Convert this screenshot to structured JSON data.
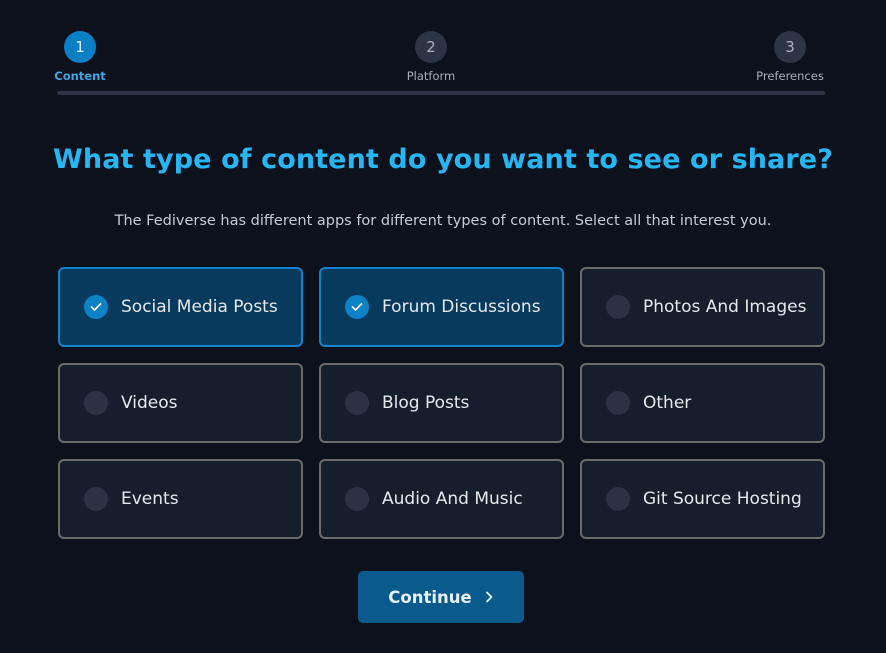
{
  "stepper": {
    "steps": [
      {
        "number": "1",
        "label": "Content",
        "active": true
      },
      {
        "number": "2",
        "label": "Platform",
        "active": false
      },
      {
        "number": "3",
        "label": "Preferences",
        "active": false
      }
    ]
  },
  "main": {
    "title": "What type of content do you want to see or share?",
    "subtitle": "The Fediverse has different apps for different types of content. Select all that interest you.",
    "options": [
      {
        "label": "Social Media Posts",
        "selected": true
      },
      {
        "label": "Forum Discussions",
        "selected": true
      },
      {
        "label": "Photos And Images",
        "selected": false
      },
      {
        "label": "Videos",
        "selected": false
      },
      {
        "label": "Blog Posts",
        "selected": false
      },
      {
        "label": "Other",
        "selected": false
      },
      {
        "label": "Events",
        "selected": false
      },
      {
        "label": "Audio And Music",
        "selected": false
      },
      {
        "label": "Git Source Hosting",
        "selected": false
      }
    ],
    "continue_label": "Continue"
  },
  "icons": {
    "check": "check-icon",
    "continue": "chevron-right-icon"
  },
  "colors": {
    "accent": "#26b6f4",
    "selected_bg": "#073a5c",
    "selected_border": "#1382cc",
    "button_bg": "#0b5a8e",
    "page_bg": "#0c111c"
  }
}
